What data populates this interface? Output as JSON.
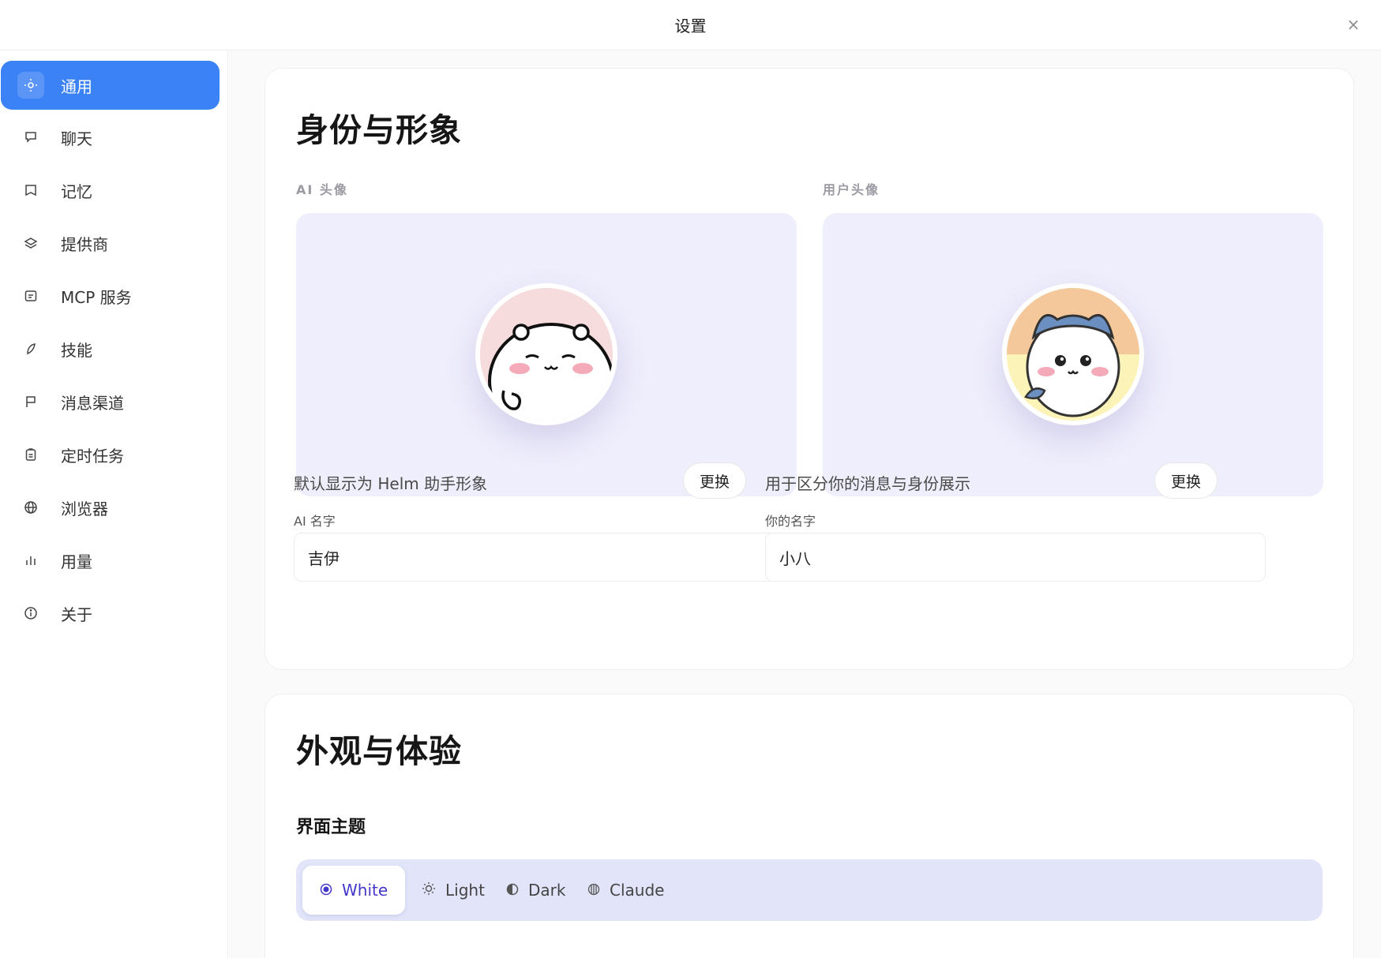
{
  "window": {
    "title": "设置",
    "close_glyph": "×"
  },
  "sidebar": {
    "items": [
      {
        "label": "通用",
        "icon": "sun-gear-icon",
        "active": true
      },
      {
        "label": "聊天",
        "icon": "chat-bubble-icon"
      },
      {
        "label": "记忆",
        "icon": "book-icon"
      },
      {
        "label": "提供商",
        "icon": "layers-icon"
      },
      {
        "label": "MCP 服务",
        "icon": "server-icon"
      },
      {
        "label": "技能",
        "icon": "leaf-icon"
      },
      {
        "label": "消息渠道",
        "icon": "flag-icon"
      },
      {
        "label": "定时任务",
        "icon": "clipboard-icon"
      },
      {
        "label": "浏览器",
        "icon": "globe-icon"
      },
      {
        "label": "用量",
        "icon": "bar-chart-icon"
      },
      {
        "label": "关于",
        "icon": "info-icon"
      }
    ]
  },
  "identity": {
    "title": "身份与形象",
    "ai": {
      "label": "AI 头像",
      "description": "默认显示为 Helm 助手形象",
      "change_label": "更换",
      "name_label": "AI 名字",
      "name_value": "吉伊"
    },
    "user": {
      "label": "用户头像",
      "description": "用于区分你的消息与身份展示",
      "change_label": "更换",
      "name_label": "你的名字",
      "name_value": "小八"
    }
  },
  "appearance": {
    "title": "外观与体验",
    "theme_label": "界面主题",
    "themes": [
      {
        "label": "White",
        "icon": "radio-dot-icon",
        "selected": true
      },
      {
        "label": "Light",
        "icon": "sun-icon"
      },
      {
        "label": "Dark",
        "icon": "half-moon-icon"
      },
      {
        "label": "Claude",
        "icon": "globe-striped-icon"
      }
    ]
  },
  "colors": {
    "accent": "#3b82f6",
    "theme_selected_text": "#4338ca",
    "avatar_bg": "#efeefc",
    "theme_bar_bg": "#e2e5fa"
  }
}
